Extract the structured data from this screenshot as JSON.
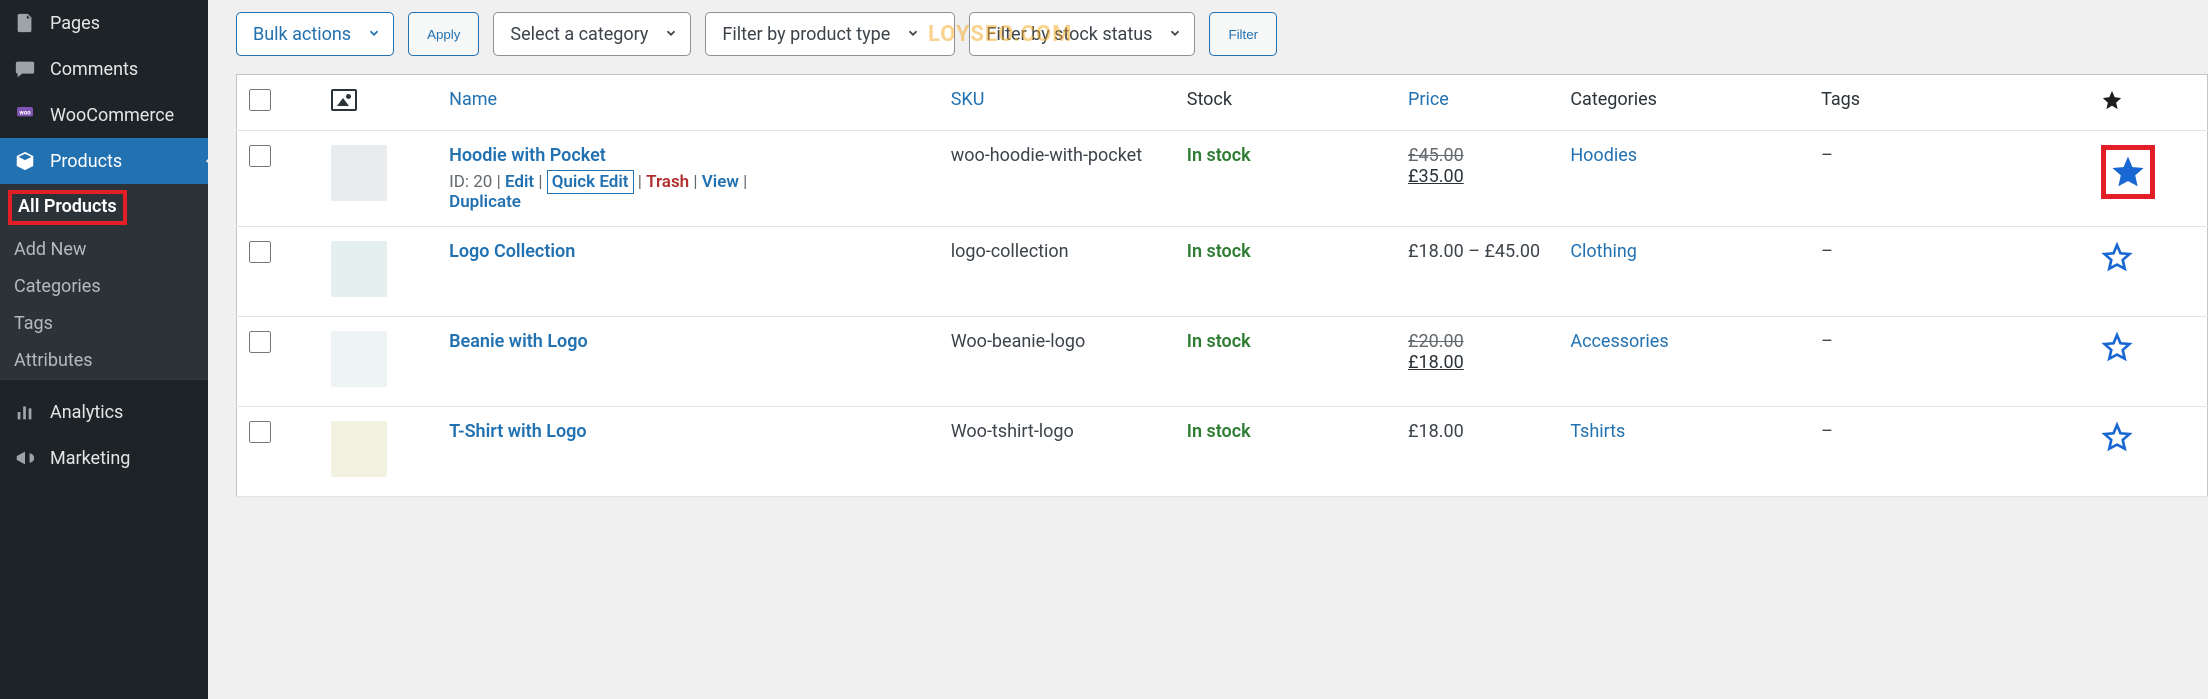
{
  "watermark": "LOYSEO.COM",
  "sidebar": {
    "items": [
      {
        "label": "Pages",
        "icon": "pages-icon"
      },
      {
        "label": "Comments",
        "icon": "comments-icon"
      },
      {
        "label": "WooCommerce",
        "icon": "woocommerce-icon"
      },
      {
        "label": "Products",
        "icon": "products-icon",
        "active": true,
        "submenu": [
          {
            "label": "All Products",
            "current": true,
            "highlight": true
          },
          {
            "label": "Add New"
          },
          {
            "label": "Categories"
          },
          {
            "label": "Tags"
          },
          {
            "label": "Attributes"
          }
        ]
      },
      {
        "label": "Analytics",
        "icon": "analytics-icon"
      },
      {
        "label": "Marketing",
        "icon": "marketing-icon"
      }
    ]
  },
  "filters": {
    "bulk_label": "Bulk actions",
    "apply_label": "Apply",
    "category_label": "Select a category",
    "type_label": "Filter by product type",
    "stock_label": "Filter by stock status",
    "filter_label": "Filter"
  },
  "columns": {
    "name": "Name",
    "sku": "SKU",
    "stock": "Stock",
    "price": "Price",
    "categories": "Categories",
    "tags": "Tags"
  },
  "row_actions": {
    "id_prefix": "ID: ",
    "edit": "Edit",
    "quick_edit": "Quick Edit",
    "trash": "Trash",
    "view": "View",
    "duplicate": "Duplicate"
  },
  "rows": [
    {
      "name": "Hoodie with Pocket",
      "id": "20",
      "show_actions": true,
      "sku": "woo-hoodie-with-pocket",
      "stock": "In stock",
      "price_original": "£45.00",
      "price_sale": "£35.00",
      "categories": "Hoodies",
      "tags": "–",
      "featured": true,
      "featured_highlight": true,
      "thumb_bg": "#e9ecef"
    },
    {
      "name": "Logo Collection",
      "sku": "logo-collection",
      "stock": "In stock",
      "price_range": "£18.00 – £45.00",
      "categories": "Clothing",
      "tags": "–",
      "featured": false,
      "thumb_bg": "#e4f0ef"
    },
    {
      "name": "Beanie with Logo",
      "sku": "Woo-beanie-logo",
      "stock": "In stock",
      "price_original": "£20.00",
      "price_sale": "£18.00",
      "categories": "Accessories",
      "tags": "–",
      "featured": false,
      "thumb_bg": "#eef3f5"
    },
    {
      "name": "T-Shirt with Logo",
      "sku": "Woo-tshirt-logo",
      "stock": "In stock",
      "price_plain": "£18.00",
      "categories": "Tshirts",
      "tags": "–",
      "featured": false,
      "thumb_bg": "#f3f1df"
    }
  ]
}
